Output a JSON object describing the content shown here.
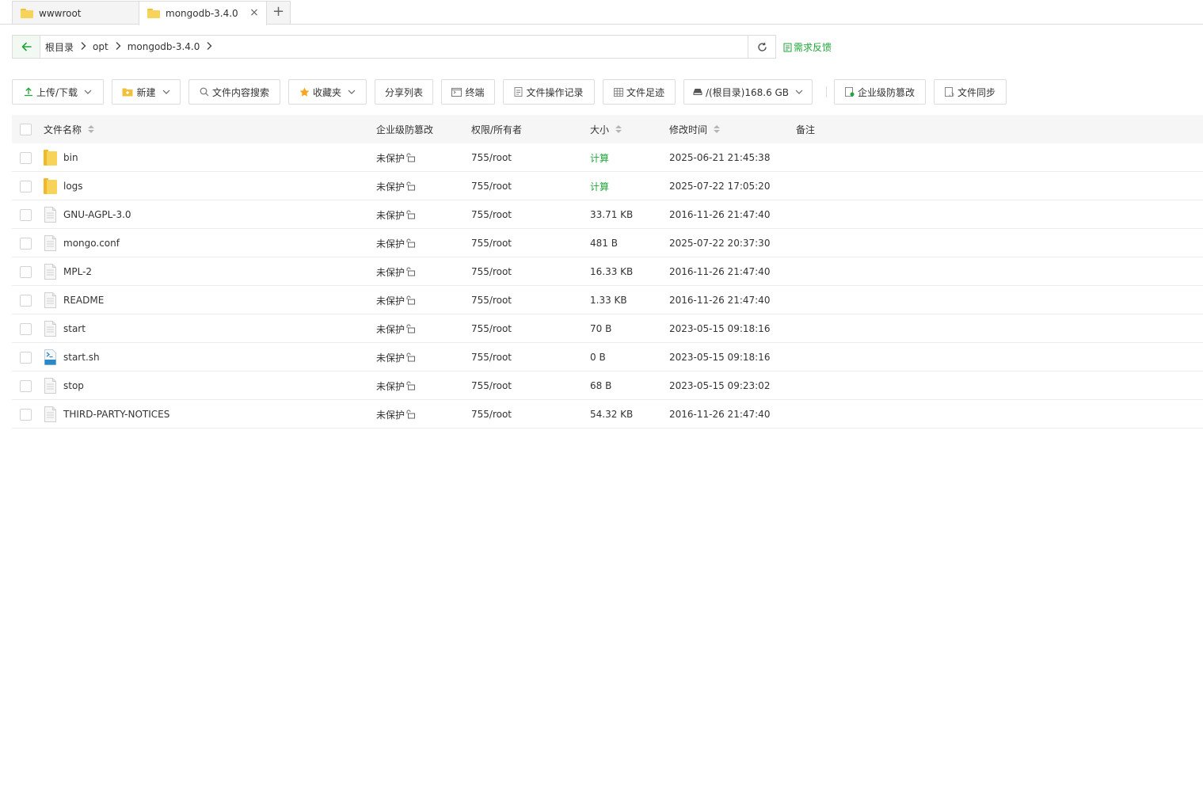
{
  "tabs": [
    {
      "label": "wwwroot",
      "active": false
    },
    {
      "label": "mongodb-3.4.0",
      "active": true
    }
  ],
  "tab_add_label": "+",
  "tab_close_label": "×",
  "breadcrumb": [
    "根目录",
    "opt",
    "mongodb-3.4.0"
  ],
  "feedback_label": "需求反馈",
  "toolbar": {
    "upload_download": "上传/下载",
    "new": "新建",
    "content_search": "文件内容搜索",
    "favorites": "收藏夹",
    "share_list": "分享列表",
    "terminal": "终端",
    "op_log": "文件操作记录",
    "footprint": "文件足迹",
    "disk": "/(根目录)168.6 GB",
    "tamper_proof": "企业级防篡改",
    "file_sync": "文件同步"
  },
  "columns": {
    "name": "文件名称",
    "protection": "企业级防篡改",
    "permission": "权限/所有者",
    "size": "大小",
    "mtime": "修改时间",
    "note": "备注"
  },
  "files": [
    {
      "name": "bin",
      "type": "folder",
      "protection": "未保护",
      "permission": "755/root",
      "size": "计算",
      "mtime": "2025-06-21 21:45:38"
    },
    {
      "name": "logs",
      "type": "folder",
      "protection": "未保护",
      "permission": "755/root",
      "size": "计算",
      "mtime": "2025-07-22 17:05:20"
    },
    {
      "name": "GNU-AGPL-3.0",
      "type": "file",
      "protection": "未保护",
      "permission": "755/root",
      "size": "33.71 KB",
      "mtime": "2016-11-26 21:47:40"
    },
    {
      "name": "mongo.conf",
      "type": "file",
      "protection": "未保护",
      "permission": "755/root",
      "size": "481 B",
      "mtime": "2025-07-22 20:37:30"
    },
    {
      "name": "MPL-2",
      "type": "file",
      "protection": "未保护",
      "permission": "755/root",
      "size": "16.33 KB",
      "mtime": "2016-11-26 21:47:40"
    },
    {
      "name": "README",
      "type": "file",
      "protection": "未保护",
      "permission": "755/root",
      "size": "1.33 KB",
      "mtime": "2016-11-26 21:47:40"
    },
    {
      "name": "start",
      "type": "file",
      "protection": "未保护",
      "permission": "755/root",
      "size": "70 B",
      "mtime": "2023-05-15 09:18:16"
    },
    {
      "name": "start.sh",
      "type": "shell",
      "protection": "未保护",
      "permission": "755/root",
      "size": "0 B",
      "mtime": "2023-05-15 09:18:16"
    },
    {
      "name": "stop",
      "type": "file",
      "protection": "未保护",
      "permission": "755/root",
      "size": "68 B",
      "mtime": "2023-05-15 09:23:02"
    },
    {
      "name": "THIRD-PARTY-NOTICES",
      "type": "file",
      "protection": "未保护",
      "permission": "755/root",
      "size": "54.32 KB",
      "mtime": "2016-11-26 21:47:40"
    }
  ],
  "colors": {
    "accent": "#20a53a",
    "border": "#dcdcdc",
    "header_bg": "#f6f6f6"
  }
}
